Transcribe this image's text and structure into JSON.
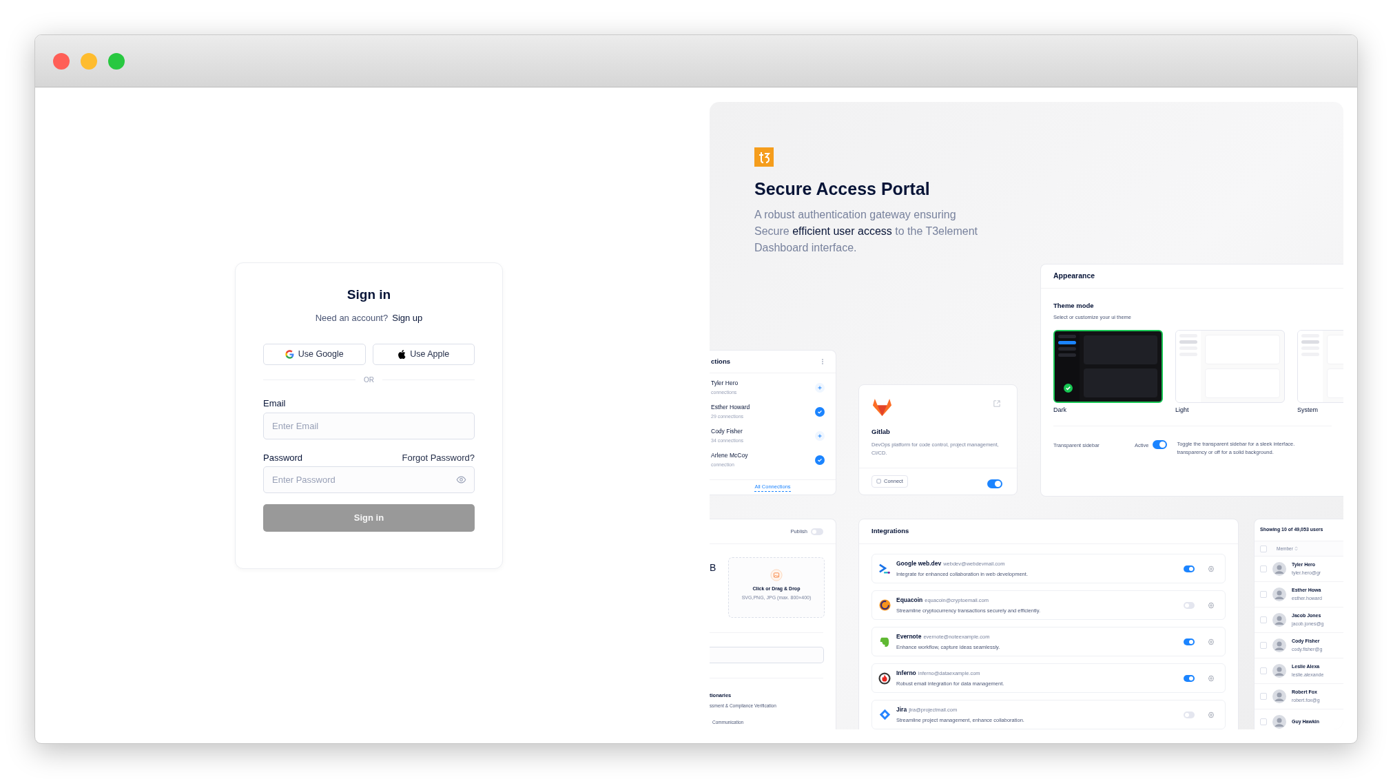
{
  "window": {
    "controls": [
      {
        "color": "#ff5f57"
      },
      {
        "color": "#febc2e"
      },
      {
        "color": "#28c840"
      }
    ]
  },
  "sign_in": {
    "title": "Sign in",
    "prompt": "Need an account?",
    "signup_link": "Sign up",
    "social_buttons": [
      {
        "kind": "google",
        "label": "Use Google"
      },
      {
        "kind": "apple",
        "label": "Use Apple"
      }
    ],
    "divider": "OR",
    "email": {
      "label": "Email",
      "placeholder": "Enter Email"
    },
    "password": {
      "label": "Password",
      "forgot_link": "Forgot Password?",
      "placeholder": "Enter Password"
    },
    "submit": {
      "label": "Sign in",
      "disabled": true
    }
  },
  "showcase": {
    "title": "Secure Access Portal",
    "description": "A robust authentication gateway ensuring Secure **efficient user access** to the T3element Dashboard interface.",
    "appearance": {
      "title": "Appearance",
      "section_title": "Theme mode",
      "section_hint": "Select or customize your ui theme",
      "themes": [
        {
          "kind": "dark",
          "label": "Dark",
          "selected": true
        },
        {
          "kind": "light",
          "label": "Light",
          "selected": false
        },
        {
          "kind": "system",
          "label": "System",
          "selected": false
        }
      ],
      "setting_label": "Transparent sidebar",
      "status": "Active",
      "on": true,
      "description_lines": [
        "Toggle the transparent sidebar for a sleek interface.",
        "transparency or off for a solid background."
      ]
    },
    "connections": {
      "title": "ctions",
      "rows": [
        {
          "name": "Tyler Hero",
          "detail": "connections",
          "connected": false
        },
        {
          "name": "Esther Howard",
          "detail": "29 connections",
          "connected": true
        },
        {
          "name": "Cody Fisher",
          "detail": "34 connections",
          "connected": false
        },
        {
          "name": "Arlene McCoy",
          "detail": "connection",
          "connected": true
        }
      ],
      "footer_link": "All Connections"
    },
    "gitlab": {
      "name": "Gitlab",
      "description": "DevOps platform for code control, project management, CI/CD.",
      "button": "Connect",
      "on": true
    },
    "upload_card": {
      "publish_label": "Publish",
      "publish_on": false,
      "value": "B",
      "drop_title": "Click or Drag & Drop",
      "drop_hint": "SVG,PNG, JPG (max. 800×400)",
      "item_title": "tionaries",
      "item_detail": "ssment & Compliance Verification",
      "next_item": "Communication"
    },
    "integrations": {
      "title": "Integrations",
      "rows": [
        {
          "name": "Google web.dev",
          "email": "webdev@webdevmail.com",
          "description": "Integrate for enhanced collaboration in web development.",
          "on": true
        },
        {
          "name": "Equacoin",
          "email": "equacoin@cryptoemail.com",
          "description": "Streamline cryptocurrency transactions securely and efficiently.",
          "on": false
        },
        {
          "name": "Evernote",
          "email": "evernote@noteexample.com",
          "description": "Enhance workflow, capture ideas seamlessly.",
          "on": true
        },
        {
          "name": "Inferno",
          "email": "inferno@dataexample.com",
          "description": "Robust email integration for data management.",
          "on": true
        },
        {
          "name": "Jira",
          "email": "jira@projectmail.com",
          "description": "Streamline project management, enhance collaboration.",
          "on": false
        }
      ]
    },
    "users": {
      "summary": "Showing 10 of 49,053 users",
      "column": "Member",
      "all_checked": false,
      "rows": [
        {
          "name": "Tyler Hero",
          "email": "tyler.hero@gr",
          "checked": false
        },
        {
          "name": "Esther Howa",
          "email": "esther.howard",
          "checked": false
        },
        {
          "name": "Jacob Jones",
          "email": "jacob.jones@g",
          "checked": false
        },
        {
          "name": "Cody Fisher",
          "email": "cody.fisher@g",
          "checked": false
        },
        {
          "name": "Leslie Alexa",
          "email": "leslie.alexande",
          "checked": false
        },
        {
          "name": "Robert Fox",
          "email": "robert.fox@g",
          "checked": false
        },
        {
          "name": "Guy Hawkin",
          "checked": false
        }
      ]
    }
  }
}
